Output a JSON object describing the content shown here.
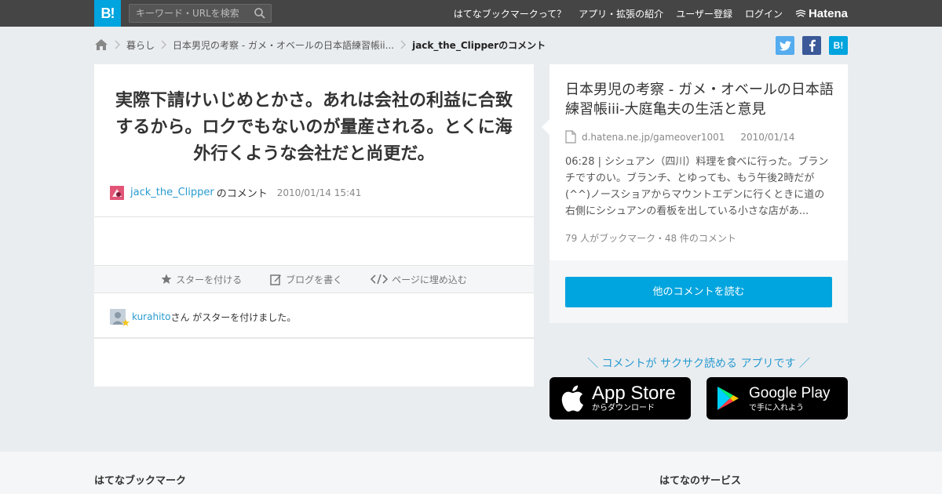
{
  "topbar": {
    "logo": "B!",
    "search_placeholder": "キーワード・URLを検索",
    "nav": [
      "はてなブックマークって？",
      "アプリ・拡張の紹介",
      "ユーザー登録",
      "ログイン"
    ],
    "brand": "Hatena"
  },
  "breadcrumb": {
    "items": [
      "暮らし",
      "日本男児の考察 - ガメ・オベールの日本語練習帳ii..."
    ],
    "current": "jack_the_Clipperのコメント"
  },
  "share": {
    "hatena": "B!"
  },
  "comment": {
    "text": "実際下請けいじめとかさ。あれは会社の利益に合致するから。ロクでもないのが量産される。とくに海外行くような会社だと尚更だ。",
    "user": "jack_the_Clipper",
    "suffix": "のコメント",
    "datetime": "2010/01/14 15:41"
  },
  "actions": {
    "star": "スターを付ける",
    "blog": "ブログを書く",
    "embed": "ページに埋め込む"
  },
  "stars": {
    "user": "kurahito",
    "text": "さん がスターを付けました。"
  },
  "entry": {
    "title": "日本男児の考察 - ガメ・オベールの日本語練習帳iii-大庭亀夫の生活と意見",
    "domain": "d.hatena.ne.jp/gameover1001",
    "date": "2010/01/14",
    "excerpt": "06:28 | シシュアン（四川）料理を食べに行った。ブランチですのい。ブランチ、とゆっても、もう午後2時だが(^^)ノースショアからマウントエデンに行くときに道の右側にシシュアンの看板を出している小さな店があ...",
    "counts": "79 人がブックマーク・48 件のコメント",
    "readmore": "他のコメントを読む"
  },
  "promo": {
    "text": "＼ コメントが サクサク読める アプリです ／",
    "apple_small": "からダウンロード",
    "apple_big": "App Store",
    "google_big": "Google Play",
    "google_small": "で手に入れよう"
  },
  "footer": {
    "left": "はてなブックマーク",
    "right": "はてなのサービス"
  },
  "colors": {
    "accent": "#00a4de",
    "topbar": "#454545",
    "link": "#2a9bd0"
  }
}
